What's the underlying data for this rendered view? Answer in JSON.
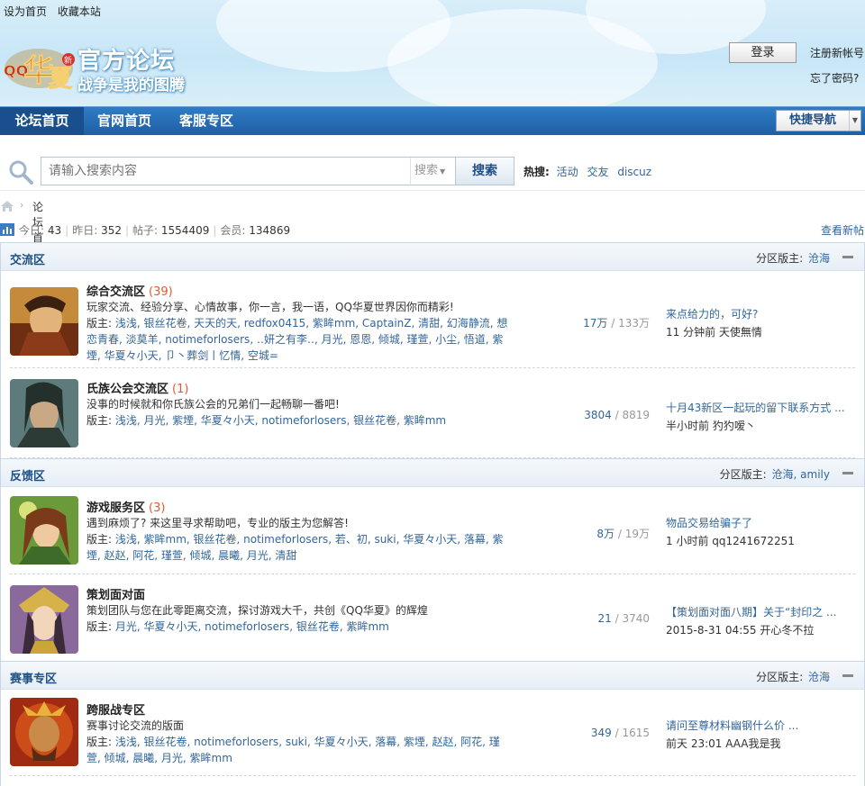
{
  "header": {
    "links": [
      "设为首页",
      "收藏本站"
    ],
    "title": "官方论坛",
    "slogan": "战争是我的图腾",
    "login": "登录",
    "register": "注册新帐号",
    "forgot": "忘了密码?"
  },
  "nav": {
    "items": [
      "论坛首页",
      "官网首页",
      "客服专区"
    ],
    "quick": "快捷导航"
  },
  "search": {
    "placeholder": "请输入搜索内容",
    "type": "搜索",
    "button": "搜索",
    "hot_label": "热搜:",
    "hot": [
      "活动",
      "交友",
      "discuz"
    ]
  },
  "breadcrumb": {
    "separator": "›",
    "current": "论坛首页"
  },
  "stats": {
    "today_label": "今日:",
    "today": "43",
    "yesterday_label": "昨日:",
    "yesterday": "352",
    "posts_label": "帖子:",
    "posts": "1554409",
    "members_label": "会员:",
    "members": "134869",
    "view_new": "查看新帖"
  },
  "categories": [
    {
      "title": "交流区",
      "mods_label": "分区版主:",
      "mods": "沧海",
      "forums": [
        {
          "name": "综合交流区",
          "today": "(39)",
          "desc": "玩家交流、经验分享、心情故事，你一言，我一语，QQ华夏世界因你而精彩!",
          "mods_label": "版主:",
          "mods": "浅浅, 银丝花卷, 天天的天, redfox0415, 紫眸mm, CaptainZ, 清甜, 幻海静流, 想恋青春, 淡莫羊, notimeforlosers, ‥妍之有李‥, 月光, 恩恩, 倾城, 瑾萱, 小尘, 悟道, 紫堙, 华夏々小天, 卩丶葬剑丨忆情, 空城=",
          "threads": "17万",
          "posts": "133万",
          "last_title": "来点给力的，可好?",
          "last_meta": "11 分钟前  天使無情"
        },
        {
          "name": "氏族公会交流区",
          "today": "(1)",
          "desc": "没事的时候就和你氏族公会的兄弟们一起畅聊一番吧!",
          "mods_label": "版主:",
          "mods": "浅浅, 月光, 紫堙, 华夏々小天, notimeforlosers, 银丝花卷, 紫眸mm",
          "threads": "3804",
          "posts": "8819",
          "last_title": "十月43新区一起玩的留下联系方式 ...",
          "last_meta": "半小时前  犳犳嗳丶"
        }
      ]
    },
    {
      "title": "反馈区",
      "mods_label": "分区版主:",
      "mods": "沧海, amily",
      "forums": [
        {
          "name": "游戏服务区",
          "today": "(3)",
          "desc": "遇到麻烦了? 来这里寻求帮助吧，专业的版主为您解答!",
          "mods_label": "版主:",
          "mods": "浅浅, 紫眸mm, 银丝花卷, notimeforlosers, 若、初, suki, 华夏々小天, 落幕, 紫堙, 赵赵, 阿花, 瑾萱, 倾城, 晨曦, 月光, 清甜",
          "threads": "8万",
          "posts": "19万",
          "last_title": "物品交易给骗子了",
          "last_meta": "1 小时前  qq1241672251"
        },
        {
          "name": "策划面对面",
          "today": "",
          "desc": "策划团队与您在此零距离交流，探讨游戏大千，共创《QQ华夏》的辉煌",
          "mods_label": "版主:",
          "mods": "月光, 华夏々小天, notimeforlosers, 银丝花卷, 紫眸mm",
          "threads": "21",
          "posts": "3740",
          "last_title": "【策划面对面八期】关于“封印之 ...",
          "last_meta": "2015-8-31 04:55  开心冬不拉"
        }
      ]
    },
    {
      "title": "赛事专区",
      "mods_label": "分区版主:",
      "mods": "沧海",
      "forums": [
        {
          "name": "跨服战专区",
          "today": "",
          "desc": "赛事讨论交流的版面",
          "mods_label": "版主:",
          "mods": "浅浅, 银丝花卷, notimeforlosers, suki, 华夏々小天, 落幕, 紫堙, 赵赵, 阿花, 瑾萱, 倾城, 晨曦, 月光, 紫眸mm",
          "threads": "349",
          "posts": "1615",
          "last_title": "请问至尊材料幽钢什么价 ...",
          "last_meta": "前天 23:01  AAA我是我"
        }
      ]
    }
  ],
  "colors": {
    "nav": "#1e5fa4",
    "link": "#336699",
    "accent": "#e4592f"
  }
}
